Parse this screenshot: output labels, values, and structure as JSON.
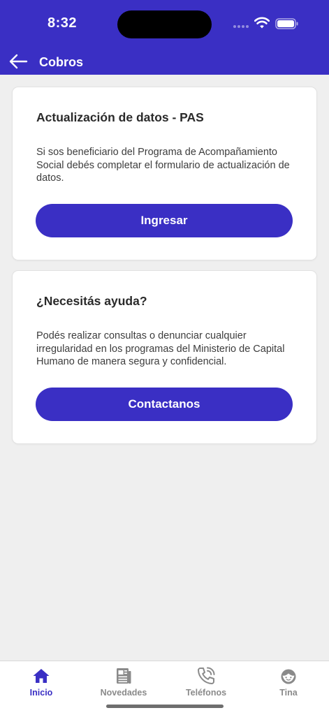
{
  "status_bar": {
    "time": "8:32"
  },
  "header": {
    "title": "Cobros",
    "back_icon": "arrow-left-icon",
    "color": "#3a2fc4"
  },
  "cards": [
    {
      "title": "Actualización de datos - PAS",
      "text": "Si sos beneficiario del Programa de Acompañamiento Social debés completar el formulario de actualización de datos.",
      "button_label": "Ingresar"
    },
    {
      "title": "¿Necesitás ayuda?",
      "text": "Podés realizar consultas o denunciar cualquier irregularidad en los programas del Ministerio de Capital Humano de manera segura y confidencial.",
      "button_label": "Contactanos"
    }
  ],
  "tabbar": {
    "active_index": 0,
    "items": [
      {
        "label": "Inicio",
        "icon": "home-icon"
      },
      {
        "label": "Novedades",
        "icon": "newspaper-icon"
      },
      {
        "label": "Teléfonos",
        "icon": "phone-icon"
      },
      {
        "label": "Tina",
        "icon": "tina-face-icon"
      }
    ]
  }
}
